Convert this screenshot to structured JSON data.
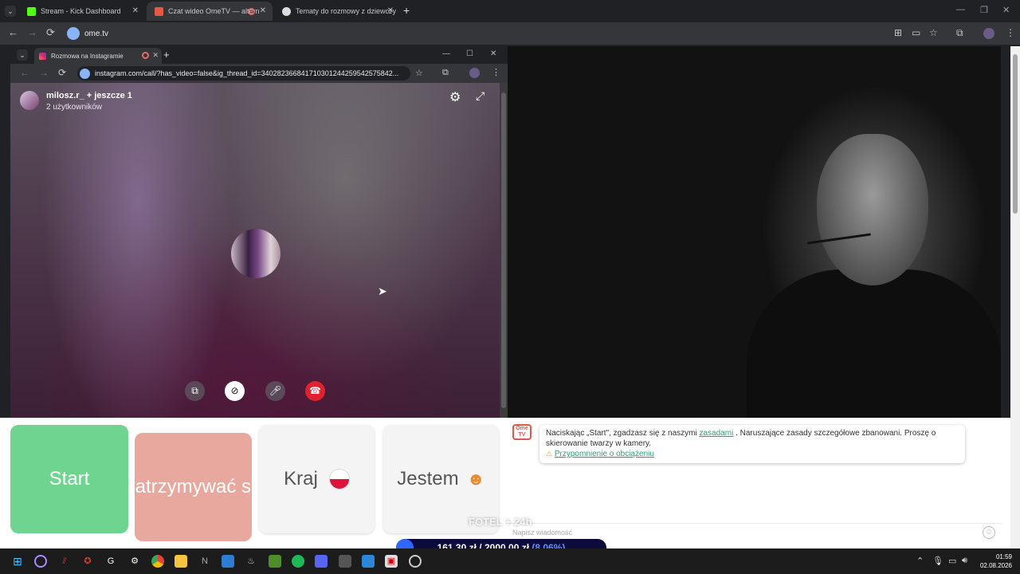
{
  "browser": {
    "tabs": [
      {
        "title": "Stream - Kick Dashboard",
        "color": "#53fc18"
      },
      {
        "title": "Czat wideo OmeTV — altern",
        "color": "#e05a47"
      },
      {
        "title": "Tematy do rozmowy z dziewczy",
        "color": "#dddddd"
      }
    ],
    "url": "ome.tv"
  },
  "inner_window": {
    "tab_title": "Rozmowa na Instagramie",
    "url": "instagram.com/call/?has_video=false&ig_thread_id=340282366841710301244259542575842..."
  },
  "call": {
    "title": "milosz.r_ + jeszcze 1",
    "subtitle": "2 użytkowników"
  },
  "buttons": {
    "start": "Start",
    "stop": "Zatrzymywać się",
    "country": "Kraj",
    "iam": "Jestem"
  },
  "chat": {
    "notice_before": "Naciskając „Start\", zgadzasz się z naszymi ",
    "notice_link": "zasadami",
    "notice_after": " . Naruszające zasady szczegółowe zbanowani. Proszę o skierowanie twarzy w kamery.",
    "reminder": "Przypomnienie o obciążeniu",
    "placeholder": "Napisz wiadomość"
  },
  "overlay": {
    "fotel": "FOTEL + 24h",
    "amount": "161,30 zł",
    "separator": "/",
    "goal": "2000,00 zł",
    "percent": "(8.06%)",
    "progress_fraction": 0.0806
  },
  "clock": {
    "time": "01:59",
    "date": "02.08.2026"
  }
}
